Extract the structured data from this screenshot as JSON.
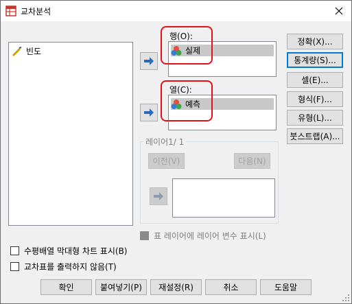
{
  "window": {
    "title": "교차분석"
  },
  "variables_list": {
    "items": [
      {
        "label": "빈도"
      }
    ]
  },
  "rows_section": {
    "label": "행(O):",
    "items": [
      {
        "label": "실제"
      }
    ]
  },
  "columns_section": {
    "label": "열(C):",
    "items": [
      {
        "label": "예측"
      }
    ]
  },
  "layer_section": {
    "label": "레이어1/ 1",
    "prev_label": "이전(V)",
    "next_label": "다음(N)",
    "display_checkbox": "표 레이어에 레이어 변수 표시(L)"
  },
  "side_buttons": {
    "exact": "정확(X)...",
    "statistics": "통계량(S)...",
    "cells": "셀(E)...",
    "format": "형식(F)...",
    "style": "유형(L)...",
    "bootstrap": "붓스트랩(A)..."
  },
  "options": {
    "clustered_bar": "수평배열 막대형 차트 표시(B)",
    "suppress_tables": "교차표를 출력하지 않음(T)"
  },
  "bottom_buttons": {
    "ok": "확인",
    "paste": "붙여넣기(P)",
    "reset": "재설정(R)",
    "cancel": "취소",
    "help": "도움말"
  },
  "colors": {
    "highlight": "#e0101a",
    "selection": "#c8c8c8",
    "arrow_blue": "#2a6bb8"
  }
}
